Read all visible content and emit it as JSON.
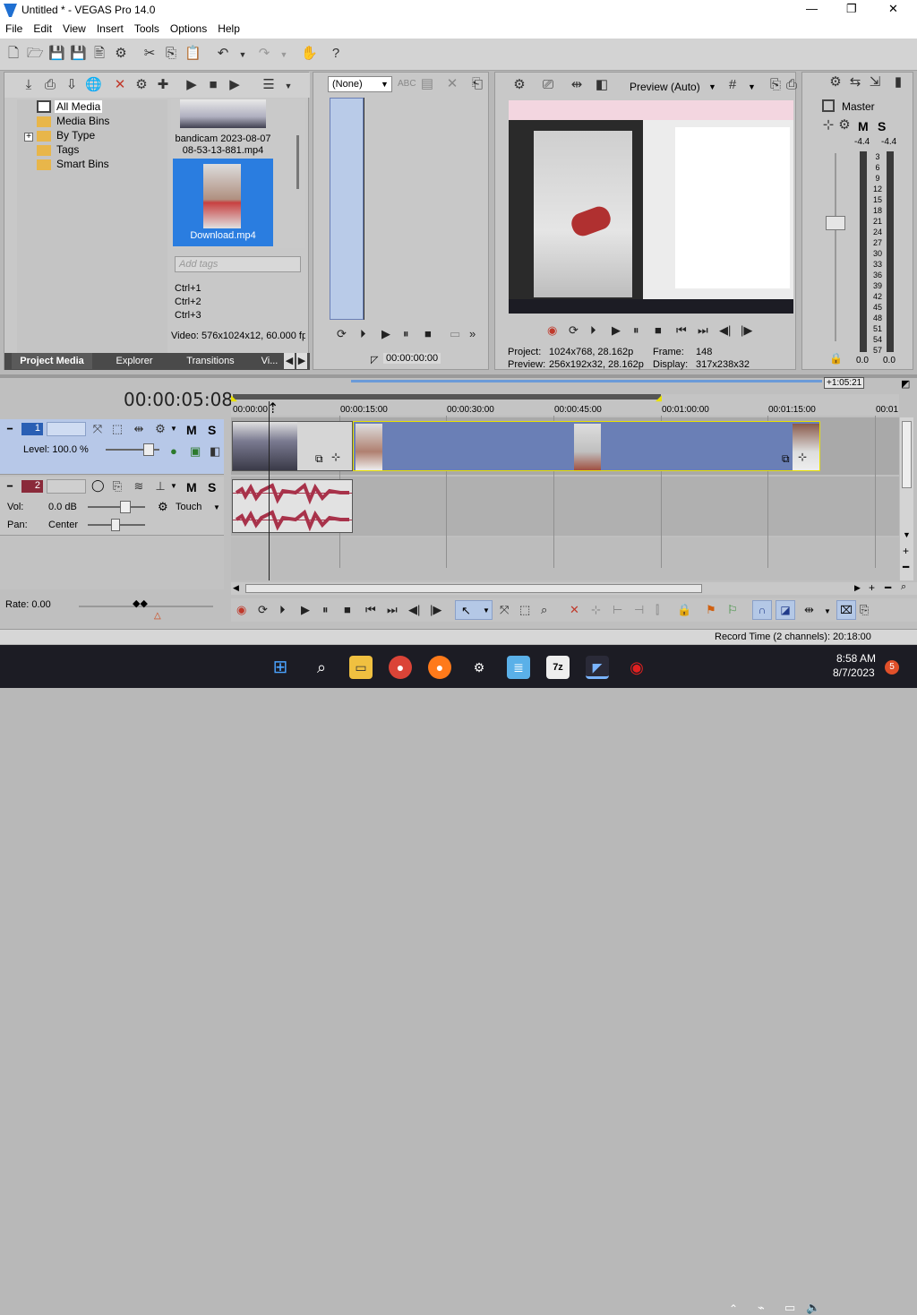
{
  "window": {
    "title": "Untitled * - VEGAS Pro 14.0",
    "min": "—",
    "max": "❐",
    "close": "✕"
  },
  "menu": [
    "File",
    "Edit",
    "View",
    "Insert",
    "Tools",
    "Options",
    "Help"
  ],
  "explorer": {
    "tree": [
      "All Media",
      "Media Bins",
      "By Type",
      "Tags",
      "Smart Bins"
    ],
    "media": [
      {
        "name": "bandicam 2023-08-07 08-53-13-881.mp4"
      },
      {
        "name": "Download.mp4"
      }
    ],
    "tags_placeholder": "Add tags",
    "shortcuts": [
      "Ctrl+1",
      "Ctrl+2",
      "Ctrl+3"
    ],
    "info": "Video: 576x1024x12, 60.000 fps",
    "tabs": [
      "Project Media",
      "Explorer",
      "Transitions",
      "Vi..."
    ]
  },
  "trimmer": {
    "preset": "(None)",
    "time": "00:00:00:00"
  },
  "preview": {
    "mode": "Preview (Auto)",
    "project_label": "Project:",
    "project_value": "1024x768, 28.162p",
    "preview_label": "Preview:",
    "preview_value": "256x192x32, 28.162p",
    "frame_label": "Frame:",
    "frame_value": "148",
    "display_label": "Display:",
    "display_value": "317x238x32"
  },
  "master": {
    "label": "Master",
    "db_left": "-4.4",
    "db_right": "-4.4",
    "scale": [
      "3",
      "6",
      "9",
      "12",
      "15",
      "18",
      "21",
      "24",
      "27",
      "30",
      "33",
      "36",
      "39",
      "42",
      "45",
      "48",
      "51",
      "54",
      "57"
    ],
    "foot_left": "0.0",
    "foot_right": "0.0",
    "ms": "M",
    "s": "S"
  },
  "timeline": {
    "timecode": "00:00:05:08",
    "end_marker": "+1:05:21",
    "ruler": [
      "00:00:00",
      "00:00:15:00",
      "00:00:30:00",
      "00:00:45:00",
      "00:01:00:00",
      "00:01:15:00",
      "00:01"
    ],
    "track1": {
      "num": "1",
      "level": "Level: 100.0 %",
      "m": "M",
      "s": "S"
    },
    "track2": {
      "num": "2",
      "vol_label": "Vol:",
      "vol_value": "0.0 dB",
      "pan_label": "Pan:",
      "pan_value": "Center",
      "touch": "Touch",
      "m": "M",
      "s": "S"
    },
    "rate": "Rate: 0.00"
  },
  "status": {
    "record": "Record Time (2 channels): 20:18:00"
  },
  "taskbar": {
    "time": "8:58 AM",
    "date": "8/7/2023",
    "badge": "5"
  },
  "colors": {
    "accent": "#3478d4",
    "video_clip": "#6a7fb6",
    "audio_clip": "#e0e0e0",
    "waveform": "#a8324a",
    "selection": "#2a7de0"
  }
}
